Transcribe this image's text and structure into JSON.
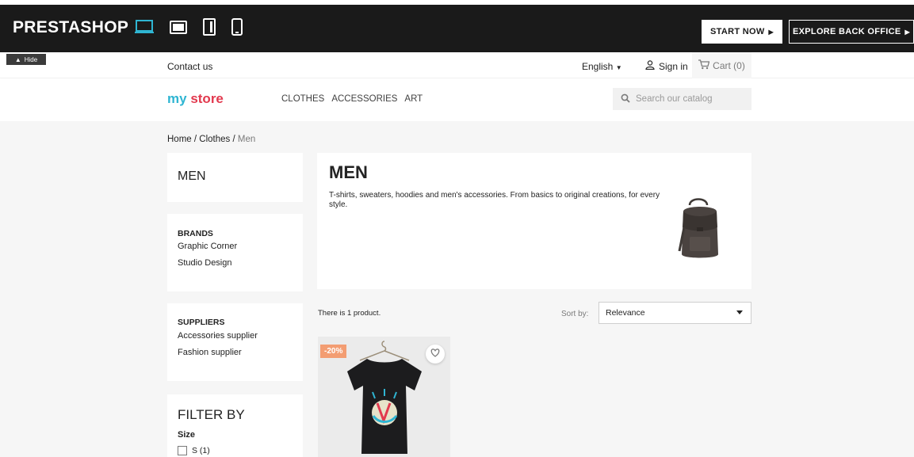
{
  "demo_bar": {
    "logo": "PRESTASHOP",
    "devices": [
      "desktop-icon",
      "tablet-landscape-icon",
      "tablet-portrait-icon",
      "mobile-icon"
    ],
    "start_now": "START NOW",
    "explore": "EXPLORE BACK OFFICE",
    "hide": "Hide"
  },
  "header": {
    "contact": "Contact us",
    "language": "English",
    "sign_in": "Sign in",
    "cart": "Cart (0)",
    "logo_my": "my",
    "logo_store": "store",
    "menu": [
      "CLOTHES",
      "ACCESSORIES",
      "ART"
    ],
    "search_placeholder": "Search our catalog"
  },
  "breadcrumb": {
    "home": "Home",
    "clothes": "Clothes",
    "current": "Men",
    "sep": "/"
  },
  "sidebar": {
    "category": "MEN",
    "brands_title": "BRANDS",
    "brands": [
      "Graphic Corner",
      "Studio Design"
    ],
    "suppliers_title": "SUPPLIERS",
    "suppliers": [
      "Accessories supplier",
      "Fashion supplier"
    ],
    "filter_title": "FILTER BY",
    "filter_size_title": "Size",
    "filter_size_options": [
      "S (1)"
    ]
  },
  "category": {
    "title": "MEN",
    "description": "T-shirts, sweaters, hoodies and men's accessories. From basics to original creations, for every style."
  },
  "listing": {
    "count_text": "There is 1 product.",
    "sort_label": "Sort by:",
    "sort_value": "Relevance",
    "products": [
      {
        "discount": "-20%"
      }
    ]
  },
  "colors": {
    "brand_blue": "#2fb5d2",
    "brand_red": "#e2394e",
    "discount_badge": "#f39d72",
    "topbar": "#1a1a1a"
  }
}
